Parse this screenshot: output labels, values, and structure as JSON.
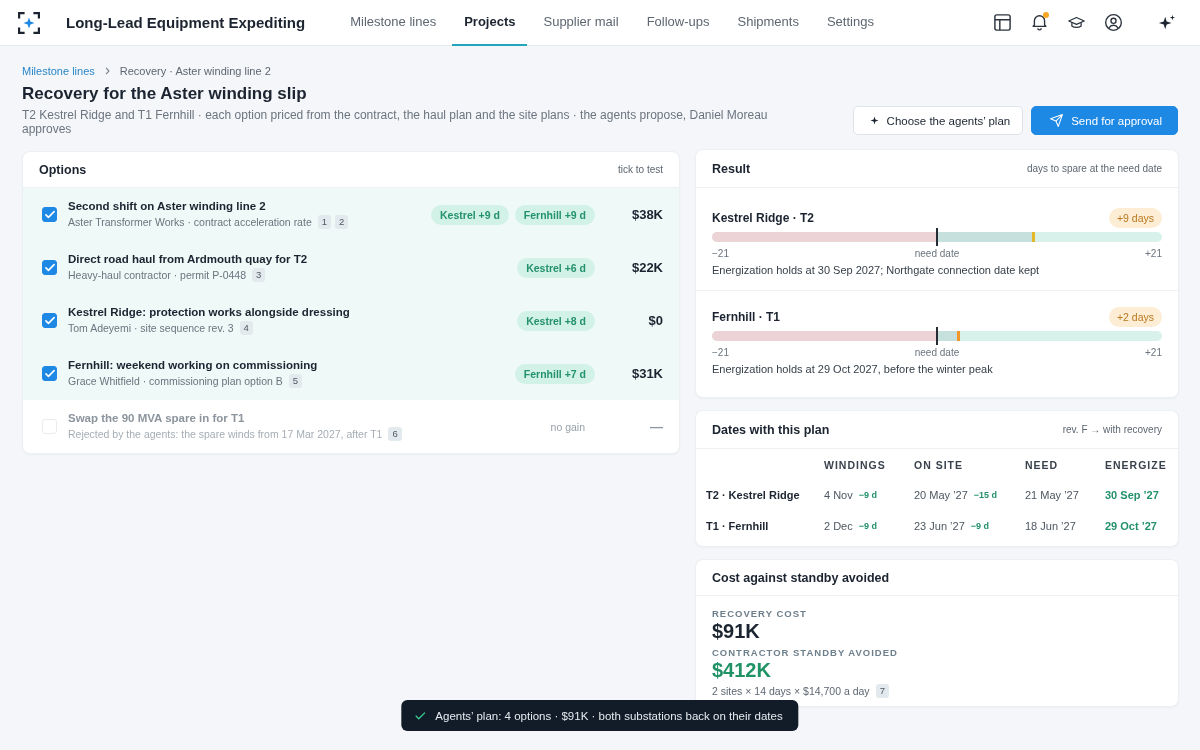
{
  "app": {
    "title": "Long-Lead Equipment Expediting"
  },
  "nav": [
    {
      "label": "Milestone lines",
      "selected": false
    },
    {
      "label": "Projects",
      "selected": true
    },
    {
      "label": "Supplier mail",
      "selected": false
    },
    {
      "label": "Follow-ups",
      "selected": false
    },
    {
      "label": "Shipments",
      "selected": false
    },
    {
      "label": "Settings",
      "selected": false
    }
  ],
  "notifications_unread": true,
  "breadcrumb": {
    "link": "Milestone lines",
    "current": "Recovery · Aster winding line 2"
  },
  "page": {
    "title": "Recovery for the Aster winding slip",
    "subtitle": "T2 Kestrel Ridge and T1 Fernhill · each option priced from the contract, the haul plan and the site plans · the agents propose, Daniel Moreau approves"
  },
  "actions": [
    {
      "label": "Choose the agents’ plan",
      "kind": "secondary"
    },
    {
      "label": "Send for approval",
      "kind": "primary"
    }
  ],
  "options": {
    "title": "Options",
    "hint": "tick to test",
    "rows": [
      {
        "checked": true,
        "disabled": false,
        "title": "Second shift on Aster winding line 2",
        "detail": "Aster Transformer Works · contract acceleration rate",
        "refs": [
          "1",
          "2"
        ],
        "gains": [
          "Kestrel +9 d",
          "Fernhill +9 d"
        ],
        "cost": "$38K"
      },
      {
        "checked": true,
        "disabled": false,
        "title": "Direct road haul from Ardmouth quay for T2",
        "detail": "Heavy-haul contractor · permit P-0448",
        "refs": [
          "3"
        ],
        "gains": [
          "Kestrel +6 d"
        ],
        "cost": "$22K"
      },
      {
        "checked": true,
        "disabled": false,
        "title": "Kestrel Ridge: protection works alongside dressing",
        "detail": "Tom Adeyemi · site sequence rev. 3",
        "refs": [
          "4"
        ],
        "gains": [
          "Kestrel +8 d"
        ],
        "cost": "$0"
      },
      {
        "checked": true,
        "disabled": false,
        "title": "Fernhill: weekend working on commissioning",
        "detail": "Grace Whitfield · commissioning plan option B",
        "refs": [
          "5"
        ],
        "gains": [
          "Fernhill +7 d"
        ],
        "cost": "$31K"
      },
      {
        "checked": false,
        "disabled": true,
        "title": "Swap the 90 MVA spare in for T1",
        "detail": "Rejected by the agents: the spare winds from 17 Mar 2027, after T1",
        "refs": [
          "6"
        ],
        "gain_note": "no gain",
        "cost": "—"
      }
    ]
  },
  "result": {
    "title": "Result",
    "hint": "days to spare at the need date",
    "sites": [
      {
        "name": "Kestrel Ridge · T2",
        "badge": "+9 days",
        "level": 0.714,
        "color": "#e2b72a",
        "scale_min": "−21",
        "scale_mid": "need date",
        "scale_max": "+21",
        "note": "Energization holds at 30 Sep 2027; Northgate connection date kept"
      },
      {
        "name": "Fernhill · T1",
        "badge": "+2 days",
        "level": 0.548,
        "color": "#f0962a",
        "scale_min": "−21",
        "scale_mid": "need date",
        "scale_max": "+21",
        "note": "Energization holds at 29 Oct 2027, before the winter peak"
      }
    ]
  },
  "dates": {
    "title": "Dates with this plan",
    "hint": "rev. F → with recovery",
    "columns": [
      "WINDINGS",
      "ON SITE",
      "NEED",
      "ENERGIZE"
    ],
    "rows": [
      {
        "site": "T2 · Kestrel Ridge",
        "windings": {
          "date": "4 Nov",
          "shift": "−9 d"
        },
        "on_site": {
          "date": "20 May ’27",
          "shift": "−15 d"
        },
        "need": "21 May ’27",
        "energize": "30 Sep ’27"
      },
      {
        "site": "T1 · Fernhill",
        "windings": {
          "date": "2 Dec",
          "shift": "−9 d"
        },
        "on_site": {
          "date": "23 Jun ’27",
          "shift": "−9 d"
        },
        "need": "18 Jun ’27",
        "energize": "29 Oct ’27"
      }
    ]
  },
  "cost": {
    "title": "Cost against standby avoided",
    "metrics": [
      {
        "label": "RECOVERY COST",
        "value": "$91K",
        "color": "#1b2430"
      },
      {
        "label": "CONTRACTOR STANDBY AVOIDED",
        "value": "$412K",
        "color": "#1f9266",
        "note": "2 sites × 14 days × $14,700 a day",
        "ref": "7"
      }
    ]
  },
  "toast": {
    "text": "Agents’ plan: 4 options · $91K · both substations back on their dates"
  }
}
